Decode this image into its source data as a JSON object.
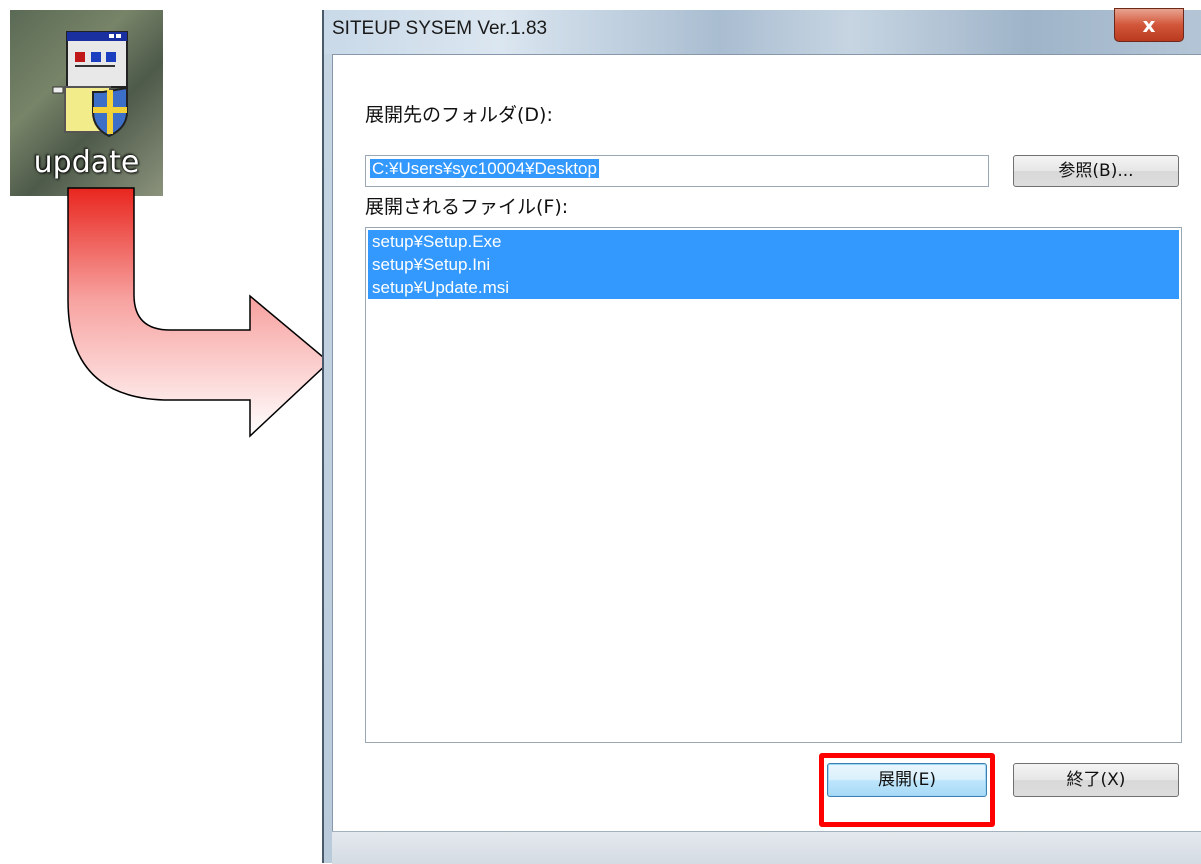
{
  "desktop": {
    "icon_label": "update"
  },
  "window": {
    "title": "SITEUP SYSEM Ver.1.83",
    "close_glyph": "x"
  },
  "form": {
    "folder_label": "展開先のフォルダ(D):",
    "folder_value": "C:¥Users¥syc10004¥Desktop",
    "browse_button": "参照(B)...",
    "files_label": "展開されるファイル(F):",
    "files": [
      "setup¥Setup.Exe",
      "setup¥Setup.Ini",
      "setup¥Update.msi"
    ],
    "extract_button": "展開(E)",
    "exit_button": "終了(X)"
  },
  "colors": {
    "selection": "#3399ff",
    "highlight_box": "#ff0000",
    "arrow_fill_top": "#e8261e",
    "arrow_fill_bottom": "#ffffff"
  },
  "icons": [
    "app-installer-icon",
    "close-icon",
    "curved-arrow"
  ]
}
